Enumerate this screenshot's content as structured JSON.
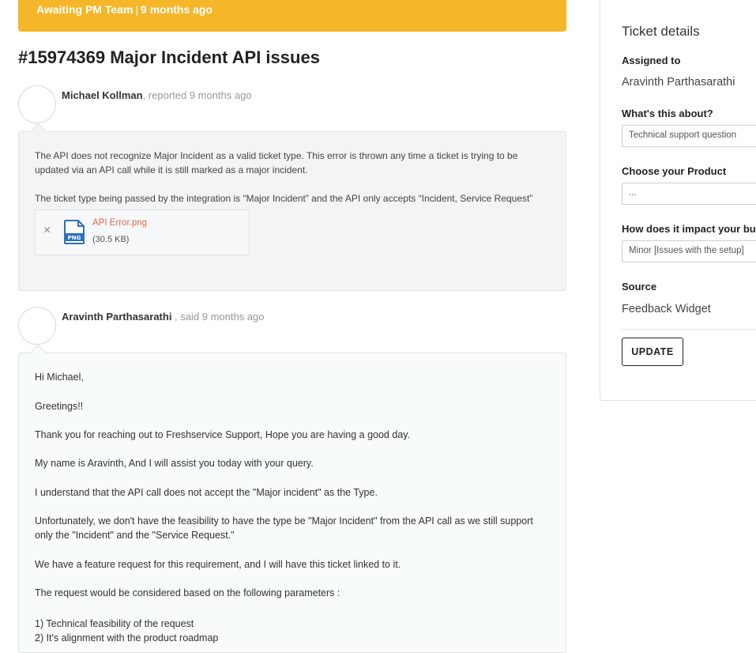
{
  "banner": {
    "status": "Awaiting PM Team",
    "separator": "|",
    "time": "9 months ago"
  },
  "ticket": {
    "title": "#15974369 Major Incident API issues"
  },
  "conversation": [
    {
      "author": "Michael Kollman",
      "action": ", reported 9 months ago",
      "paragraphs": [
        "The API does not recognize Major Incident as a valid ticket type. This error is thrown any time a ticket is trying to be updated via an API call while it is still marked as a major incident.",
        "The ticket type being passed by the integration is “Major Incident” and the API only accepts “Incident, Service Request”"
      ],
      "attachment": {
        "remove": "×",
        "icon": "png-file-icon",
        "icon_label": "PNG",
        "name": "API Error.png",
        "size": "(30.5 KB)"
      }
    },
    {
      "author": "Aravinth Parthasarathi",
      "action": " , said 9 months ago",
      "paragraphs": [
        "Hi Michael,",
        "Greetings!!",
        "Thank you for reaching out to Freshservice Support, Hope you are having a good day.",
        "My name is Aravinth, And I will assist you today with your query.",
        "I understand that the API call does not accept the \"Major incident\" as the Type.",
        "Unfortunately, we don't have the feasibility to have the type be \"Major Incident\" from the API call as we still support only the \"Incident\" and the \"Service Request.\"",
        "We have a feature request for this requirement, and I will have this ticket linked to it.",
        "The request would be considered based on the following parameters :",
        "1) Technical feasibility of the request",
        "2) It's alignment with the product roadmap"
      ]
    }
  ],
  "sidebar": {
    "title": "Ticket details",
    "assigned_label": "Assigned to",
    "assigned_value": "Aravinth Parthasarathi",
    "about_label": "What's this about?",
    "about_value": "Technical support question",
    "product_label": "Choose your Product",
    "product_value": "...",
    "impact_label": "How does it impact your bus",
    "impact_value": "Minor [Issues with the setup]",
    "source_label": "Source",
    "source_value": "Feedback Widget",
    "update_label": "UPDATE"
  },
  "colors": {
    "banner": "#f5b62a",
    "link": "#e06a4f",
    "file_icon": "#2f6fbd"
  }
}
